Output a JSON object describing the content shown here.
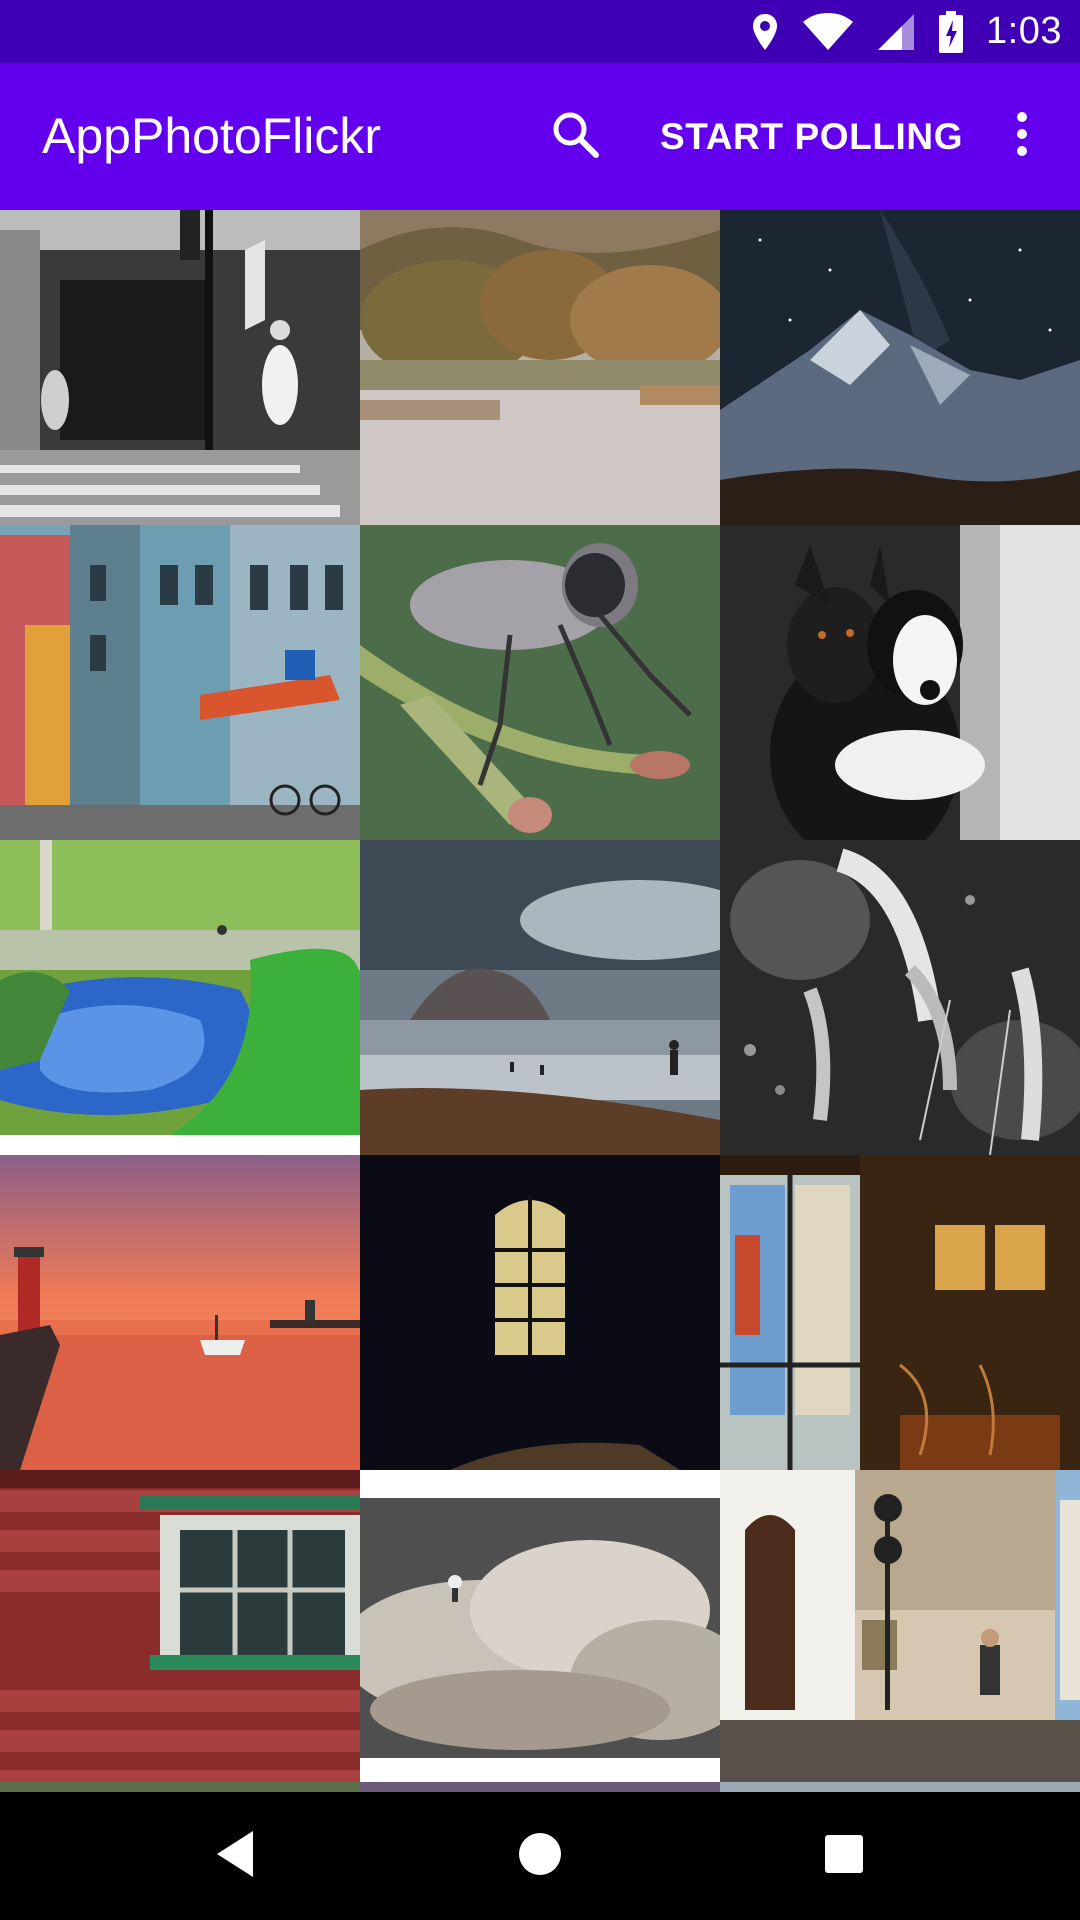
{
  "status_bar": {
    "time": "1:03",
    "icons": [
      "location-icon",
      "wifi-icon",
      "signal-icon",
      "battery-charging-icon"
    ],
    "background": "#3f00b5"
  },
  "app_bar": {
    "title": "AppPhotoFlickr",
    "search_icon": "search-icon",
    "action_label": "START POLLING",
    "overflow_icon": "more-vert-icon",
    "background": "#6200ee"
  },
  "gallery": {
    "columns": 3,
    "photos": [
      {
        "subject": "street-bw"
      },
      {
        "subject": "misty-lake"
      },
      {
        "subject": "night-mountain"
      },
      {
        "subject": "colorful-buildings"
      },
      {
        "subject": "robber-fly"
      },
      {
        "subject": "two-dogs"
      },
      {
        "subject": "green-stream"
      },
      {
        "subject": "foggy-beach"
      },
      {
        "subject": "grass-bw"
      },
      {
        "subject": "sunset-lighthouse"
      },
      {
        "subject": "dark-window"
      },
      {
        "subject": "museum-room"
      },
      {
        "subject": "red-wooden-wall"
      },
      {
        "subject": "stormy-wave"
      },
      {
        "subject": "white-street"
      }
    ]
  },
  "nav_bar": {
    "buttons": [
      "back-icon",
      "home-icon",
      "recents-icon"
    ]
  }
}
